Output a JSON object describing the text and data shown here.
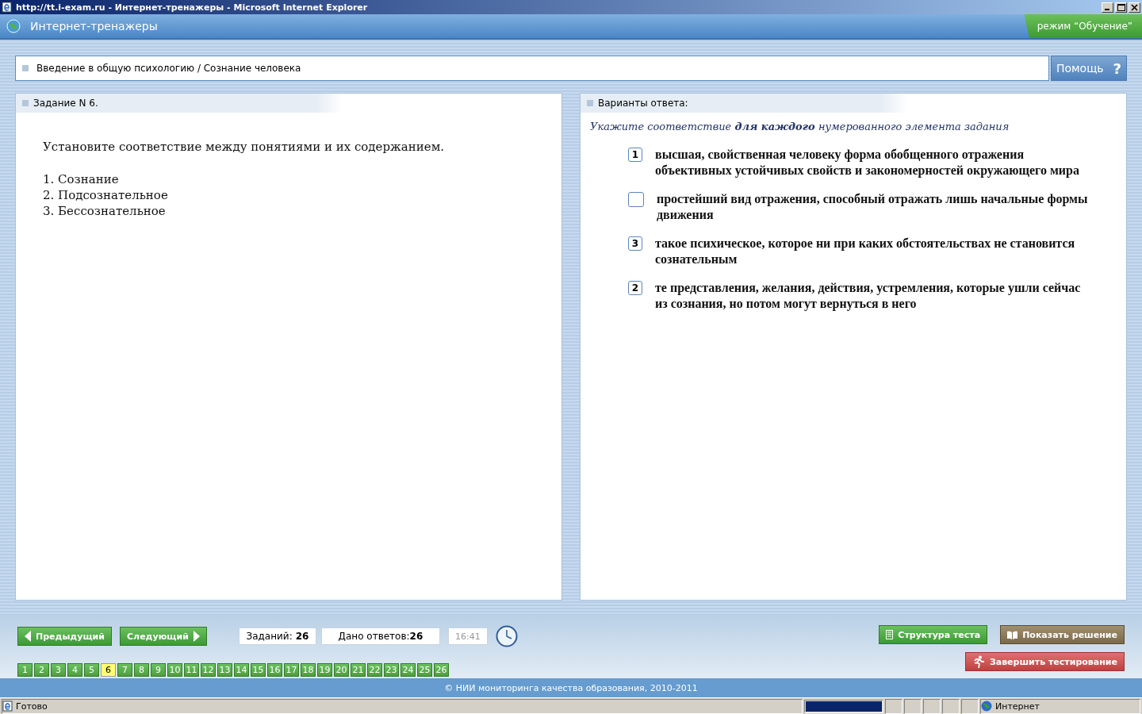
{
  "window": {
    "title": "http://tt.i-exam.ru - Интернет-тренажеры - Microsoft Internet Explorer"
  },
  "header": {
    "title": "Интернет-тренажеры",
    "mode": "режим “Обучение”"
  },
  "breadcrumb": {
    "text": "Введение в общую психологию / Сознание человека",
    "help": "Помощь",
    "help_mark": "?"
  },
  "task": {
    "heading": "Задание N 6.",
    "question": "Установите соответствие между понятиями и их содержанием.",
    "items": [
      "1. Сознание",
      "2. Подсознательное",
      "3. Бессознательное"
    ]
  },
  "answers": {
    "heading": "Варианты ответа:",
    "instruction": "Укажите соответствие **для каждого** нумерованного элемента задания",
    "options": [
      {
        "value": "1",
        "text": "высшая, свойственная человеку форма обобщенного отражения объективных устойчивых свойств и закономерностей окружающего мира"
      },
      {
        "text": "простейший вид отражения, способный отражать лишь начальные формы движения"
      },
      {
        "value": "3",
        "text": "такое психическое, которое ни при каких обстоятельствах не становится сознательным"
      },
      {
        "value": "2",
        "text": "те представления, желания, действия, устремления, которые ушли сейчас из сознания, но потом могут вернуться в него"
      }
    ]
  },
  "nav": {
    "prev": "Предыдущий",
    "next": "Следующий",
    "tasks_label": "Заданий:",
    "tasks_count": "26",
    "answered_label": "Дано ответов:",
    "answered_count": "26",
    "time": "16:41",
    "structure": "Структура теста",
    "show_solution": "Показать решение",
    "finish": "Завершить тестирование",
    "pages": [
      {
        "label": "1",
        "selected": false
      },
      {
        "label": "2",
        "selected": false
      },
      {
        "label": "3",
        "selected": false
      },
      {
        "label": "4",
        "selected": false
      },
      {
        "label": "5",
        "selected": false
      },
      {
        "label": "6",
        "selected": true
      },
      {
        "label": "7",
        "selected": false
      },
      {
        "label": "8",
        "selected": false
      },
      {
        "label": "9",
        "selected": false
      },
      {
        "label": "10",
        "selected": false
      },
      {
        "label": "11",
        "selected": false
      },
      {
        "label": "12",
        "selected": false
      },
      {
        "label": "13",
        "selected": false
      },
      {
        "label": "14",
        "selected": false
      },
      {
        "label": "15",
        "selected": false
      },
      {
        "label": "16",
        "selected": false
      },
      {
        "label": "17",
        "selected": false
      },
      {
        "label": "18",
        "selected": false
      },
      {
        "label": "19",
        "selected": false
      },
      {
        "label": "20",
        "selected": false
      },
      {
        "label": "21",
        "selected": false
      },
      {
        "label": "22",
        "selected": false
      },
      {
        "label": "23",
        "selected": false
      },
      {
        "label": "24",
        "selected": false
      },
      {
        "label": "25",
        "selected": false
      },
      {
        "label": "26",
        "selected": false
      }
    ]
  },
  "footer": {
    "text": "© НИИ мониторинга качества образования, 2010-2011"
  },
  "status_bar": {
    "text": "Готово",
    "progress": {
      "level": 1
    },
    "zone": "Интернет"
  }
}
